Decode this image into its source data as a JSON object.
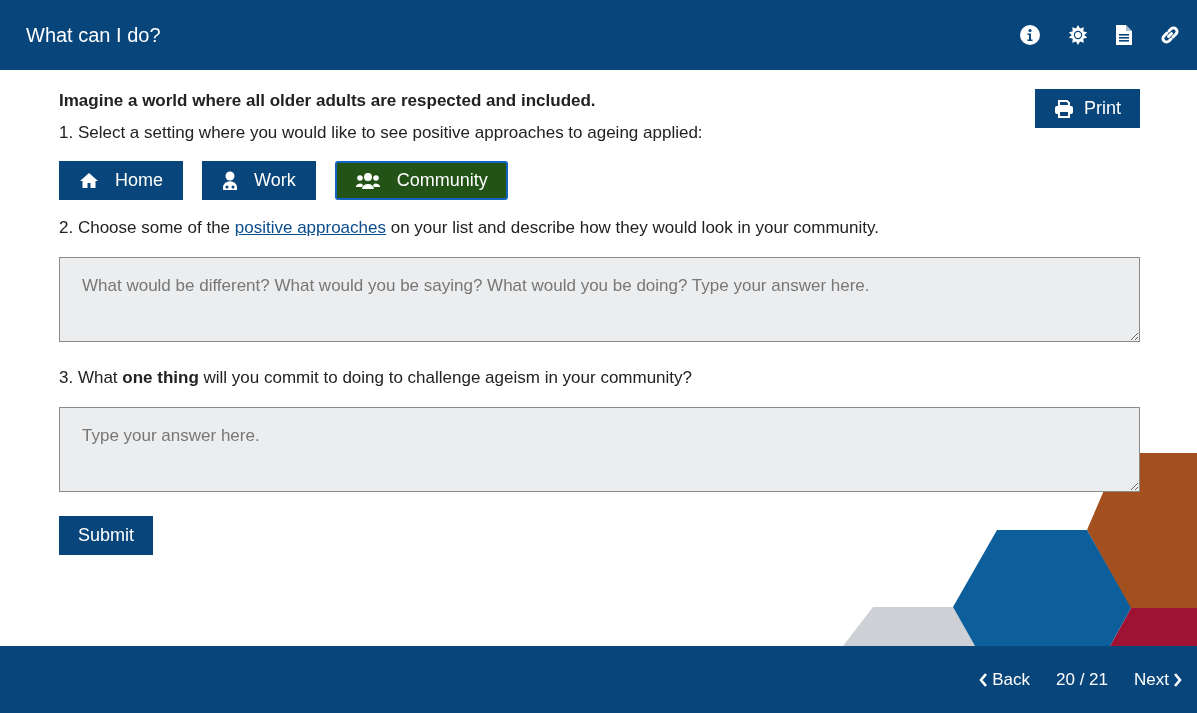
{
  "header": {
    "title": "What can I do?",
    "icons": [
      {
        "kind": "info"
      },
      {
        "kind": "brightness"
      },
      {
        "kind": "document"
      },
      {
        "kind": "link"
      }
    ]
  },
  "intro": "Imagine a world where all older adults are respected and included.",
  "print_button": {
    "label": "Print"
  },
  "step_1": "1. Select a setting where you would like to see positive approaches to ageing applied:",
  "settings": [
    {
      "label": "Home",
      "kind": "home",
      "selected": false
    },
    {
      "label": "Work",
      "kind": "work",
      "selected": false
    },
    {
      "label": "Community",
      "kind": "community",
      "selected": true
    }
  ],
  "step_2": {
    "before": "2. Choose some of the ",
    "link": "positive approaches",
    "after": " on your list and describe how they would look in your community."
  },
  "answer_1": {
    "placeholder": "What would be different? What would you be saying? What would you be doing? Type your answer here."
  },
  "step_3": "3. What **one thing** will you commit to doing to challenge ageism in your community?",
  "answer_2": {
    "placeholder": "Type your answer here."
  },
  "submit_button": {
    "label": "Submit"
  },
  "footer": {
    "back": "Back",
    "page": "20 / 21",
    "next": "Next"
  }
}
